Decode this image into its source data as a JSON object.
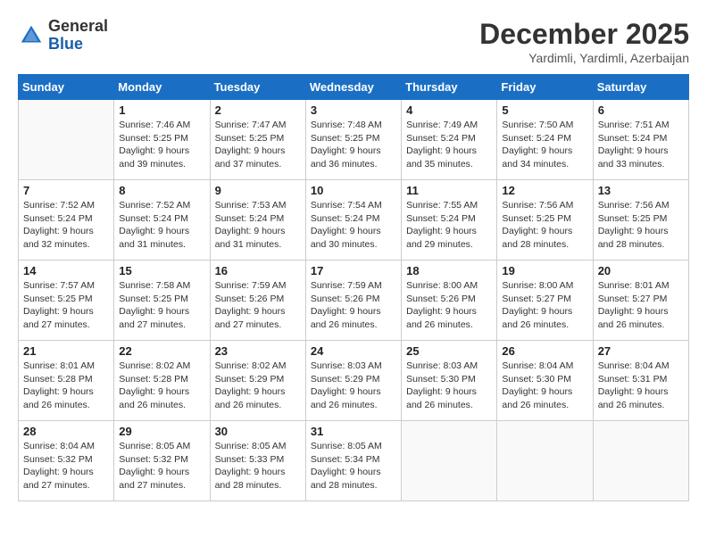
{
  "header": {
    "logo_general": "General",
    "logo_blue": "Blue",
    "month_title": "December 2025",
    "location": "Yardimli, Yardimli, Azerbaijan"
  },
  "weekdays": [
    "Sunday",
    "Monday",
    "Tuesday",
    "Wednesday",
    "Thursday",
    "Friday",
    "Saturday"
  ],
  "weeks": [
    [
      {
        "day": "",
        "info": ""
      },
      {
        "day": "1",
        "info": "Sunrise: 7:46 AM\nSunset: 5:25 PM\nDaylight: 9 hours\nand 39 minutes."
      },
      {
        "day": "2",
        "info": "Sunrise: 7:47 AM\nSunset: 5:25 PM\nDaylight: 9 hours\nand 37 minutes."
      },
      {
        "day": "3",
        "info": "Sunrise: 7:48 AM\nSunset: 5:25 PM\nDaylight: 9 hours\nand 36 minutes."
      },
      {
        "day": "4",
        "info": "Sunrise: 7:49 AM\nSunset: 5:24 PM\nDaylight: 9 hours\nand 35 minutes."
      },
      {
        "day": "5",
        "info": "Sunrise: 7:50 AM\nSunset: 5:24 PM\nDaylight: 9 hours\nand 34 minutes."
      },
      {
        "day": "6",
        "info": "Sunrise: 7:51 AM\nSunset: 5:24 PM\nDaylight: 9 hours\nand 33 minutes."
      }
    ],
    [
      {
        "day": "7",
        "info": "Sunrise: 7:52 AM\nSunset: 5:24 PM\nDaylight: 9 hours\nand 32 minutes."
      },
      {
        "day": "8",
        "info": "Sunrise: 7:52 AM\nSunset: 5:24 PM\nDaylight: 9 hours\nand 31 minutes."
      },
      {
        "day": "9",
        "info": "Sunrise: 7:53 AM\nSunset: 5:24 PM\nDaylight: 9 hours\nand 31 minutes."
      },
      {
        "day": "10",
        "info": "Sunrise: 7:54 AM\nSunset: 5:24 PM\nDaylight: 9 hours\nand 30 minutes."
      },
      {
        "day": "11",
        "info": "Sunrise: 7:55 AM\nSunset: 5:24 PM\nDaylight: 9 hours\nand 29 minutes."
      },
      {
        "day": "12",
        "info": "Sunrise: 7:56 AM\nSunset: 5:25 PM\nDaylight: 9 hours\nand 28 minutes."
      },
      {
        "day": "13",
        "info": "Sunrise: 7:56 AM\nSunset: 5:25 PM\nDaylight: 9 hours\nand 28 minutes."
      }
    ],
    [
      {
        "day": "14",
        "info": "Sunrise: 7:57 AM\nSunset: 5:25 PM\nDaylight: 9 hours\nand 27 minutes."
      },
      {
        "day": "15",
        "info": "Sunrise: 7:58 AM\nSunset: 5:25 PM\nDaylight: 9 hours\nand 27 minutes."
      },
      {
        "day": "16",
        "info": "Sunrise: 7:59 AM\nSunset: 5:26 PM\nDaylight: 9 hours\nand 27 minutes."
      },
      {
        "day": "17",
        "info": "Sunrise: 7:59 AM\nSunset: 5:26 PM\nDaylight: 9 hours\nand 26 minutes."
      },
      {
        "day": "18",
        "info": "Sunrise: 8:00 AM\nSunset: 5:26 PM\nDaylight: 9 hours\nand 26 minutes."
      },
      {
        "day": "19",
        "info": "Sunrise: 8:00 AM\nSunset: 5:27 PM\nDaylight: 9 hours\nand 26 minutes."
      },
      {
        "day": "20",
        "info": "Sunrise: 8:01 AM\nSunset: 5:27 PM\nDaylight: 9 hours\nand 26 minutes."
      }
    ],
    [
      {
        "day": "21",
        "info": "Sunrise: 8:01 AM\nSunset: 5:28 PM\nDaylight: 9 hours\nand 26 minutes."
      },
      {
        "day": "22",
        "info": "Sunrise: 8:02 AM\nSunset: 5:28 PM\nDaylight: 9 hours\nand 26 minutes."
      },
      {
        "day": "23",
        "info": "Sunrise: 8:02 AM\nSunset: 5:29 PM\nDaylight: 9 hours\nand 26 minutes."
      },
      {
        "day": "24",
        "info": "Sunrise: 8:03 AM\nSunset: 5:29 PM\nDaylight: 9 hours\nand 26 minutes."
      },
      {
        "day": "25",
        "info": "Sunrise: 8:03 AM\nSunset: 5:30 PM\nDaylight: 9 hours\nand 26 minutes."
      },
      {
        "day": "26",
        "info": "Sunrise: 8:04 AM\nSunset: 5:30 PM\nDaylight: 9 hours\nand 26 minutes."
      },
      {
        "day": "27",
        "info": "Sunrise: 8:04 AM\nSunset: 5:31 PM\nDaylight: 9 hours\nand 26 minutes."
      }
    ],
    [
      {
        "day": "28",
        "info": "Sunrise: 8:04 AM\nSunset: 5:32 PM\nDaylight: 9 hours\nand 27 minutes."
      },
      {
        "day": "29",
        "info": "Sunrise: 8:05 AM\nSunset: 5:32 PM\nDaylight: 9 hours\nand 27 minutes."
      },
      {
        "day": "30",
        "info": "Sunrise: 8:05 AM\nSunset: 5:33 PM\nDaylight: 9 hours\nand 28 minutes."
      },
      {
        "day": "31",
        "info": "Sunrise: 8:05 AM\nSunset: 5:34 PM\nDaylight: 9 hours\nand 28 minutes."
      },
      {
        "day": "",
        "info": ""
      },
      {
        "day": "",
        "info": ""
      },
      {
        "day": "",
        "info": ""
      }
    ]
  ]
}
